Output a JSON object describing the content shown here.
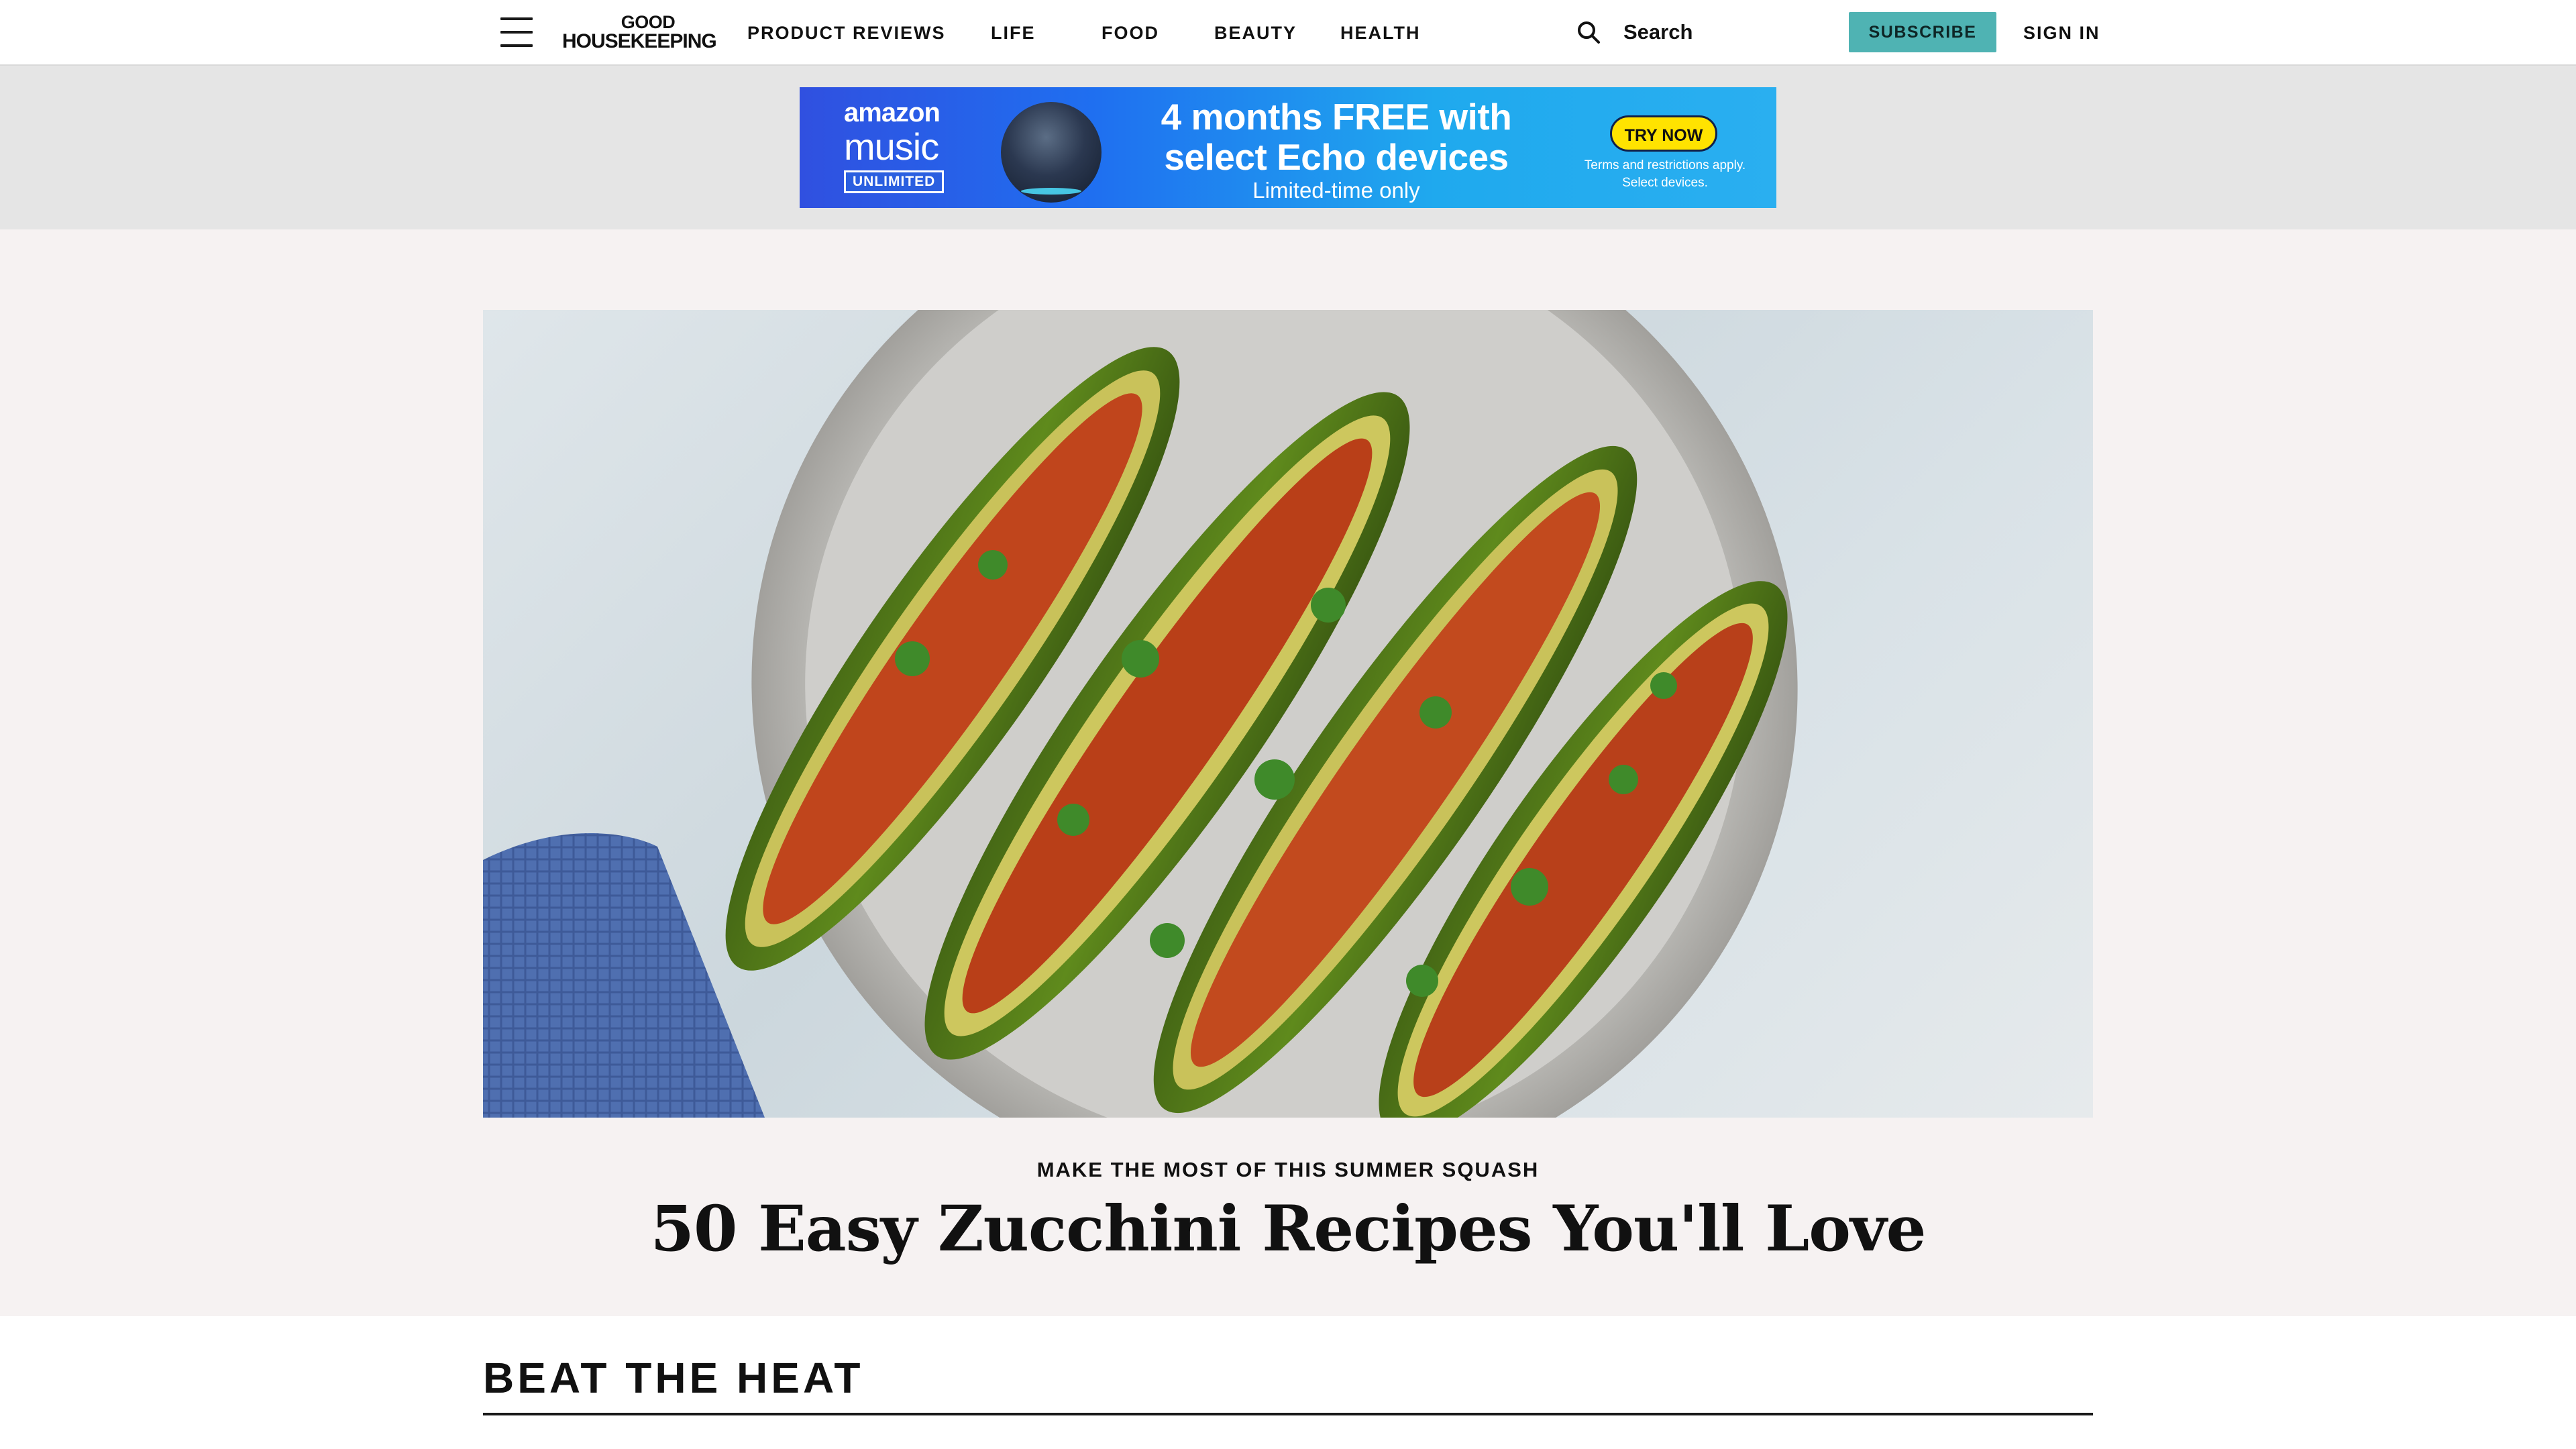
{
  "header": {
    "logo_line1": "GOOD",
    "logo_line2": "HOUSEKEEPING",
    "nav": [
      "PRODUCT REVIEWS",
      "LIFE",
      "FOOD",
      "BEAUTY",
      "HEALTH"
    ],
    "search_label": "Search",
    "subscribe_label": "SUBSCRIBE",
    "signin_label": "SIGN IN",
    "accent_color": "#4fb3b3"
  },
  "ad": {
    "brand_line1": "amazon",
    "brand_line2": "music",
    "brand_badge": "UNLIMITED",
    "headline": "4 months FREE with select Echo devices",
    "subline": "Limited-time only",
    "cta": "TRY NOW",
    "terms": "Terms and restrictions apply. Select devices."
  },
  "hero": {
    "dek": "MAKE THE MOST OF THIS SUMMER SQUASH",
    "title": "50 Easy Zucchini Recipes You'll Love"
  },
  "section": {
    "heading": "BEAT THE HEAT"
  },
  "icons": {
    "menu": "hamburger-menu-icon",
    "search": "search-icon"
  }
}
